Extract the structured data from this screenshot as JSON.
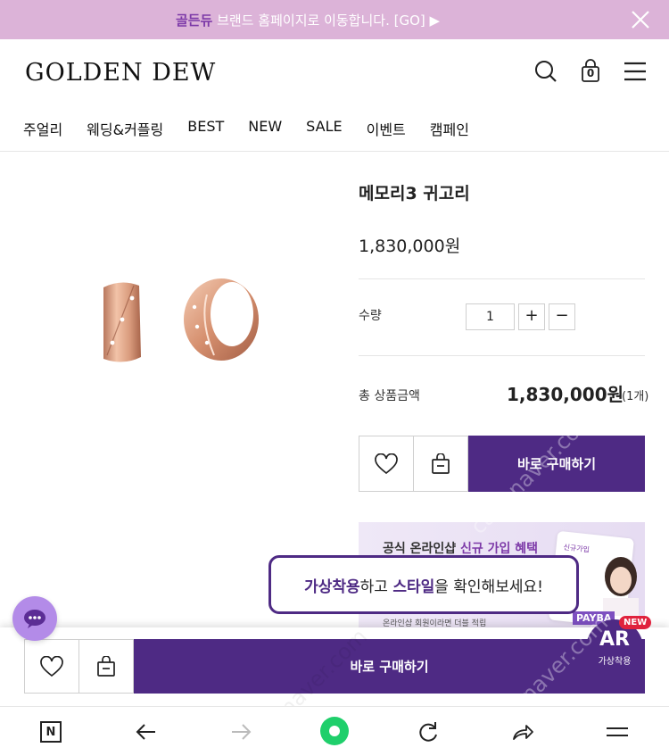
{
  "promo": {
    "brand": "골든듀",
    "text": " 브랜드 홈페이지로 이동합니다. [GO] ▶",
    "bg_color": "#dcb3d8",
    "close_icon": "close-icon"
  },
  "header": {
    "logo": "GOLDEN DEW",
    "icons": [
      "search-icon",
      "shopping-bag-icon",
      "menu-icon"
    ],
    "cart_count": "0"
  },
  "nav": {
    "items": [
      {
        "label": "주얼리"
      },
      {
        "label": "웨딩&커플링"
      },
      {
        "label": "BEST"
      },
      {
        "label": "NEW"
      },
      {
        "label": "SALE"
      },
      {
        "label": "이벤트"
      },
      {
        "label": "캠페인"
      }
    ]
  },
  "product": {
    "name": "메모리3 귀고리",
    "price": "1,830,000원",
    "quantity_label": "수량",
    "quantity": "1",
    "plus": "+",
    "minus": "−",
    "total_label": "총 상품금액",
    "total_price": "1,830,000원",
    "total_count": "(1개)",
    "buy_label": "바로 구매하기"
  },
  "event_banner": {
    "title_prefix": "공식 온라인샵 ",
    "title_highlight": "신규 가입 혜택",
    "subtitle": "온라인샵 회원이라면 더블 적립",
    "card_text": "신규가입",
    "payback": "PAYBA"
  },
  "ar_popup": {
    "b1": "가상착용",
    "t1": "하고 ",
    "b2": "스타일",
    "t2": "을 확인해보세요!"
  },
  "sticky": {
    "buy_label": "바로 구매하기"
  },
  "ar_badge": {
    "big": "AR",
    "small": "가상착용",
    "new": "NEW"
  },
  "browser_toolbar": {
    "n_label": "N",
    "icons": [
      "naver-n-icon",
      "back-arrow-icon",
      "forward-arrow-icon",
      "green-dot-icon",
      "reload-icon",
      "share-icon",
      "menu-icon"
    ]
  },
  "watermark": "cafe.naver.com",
  "colors": {
    "accent": "#4e2a84",
    "promo_bg": "#dcb3d8",
    "chat_bg": "#b38be8",
    "new_tag": "#e0223d"
  }
}
